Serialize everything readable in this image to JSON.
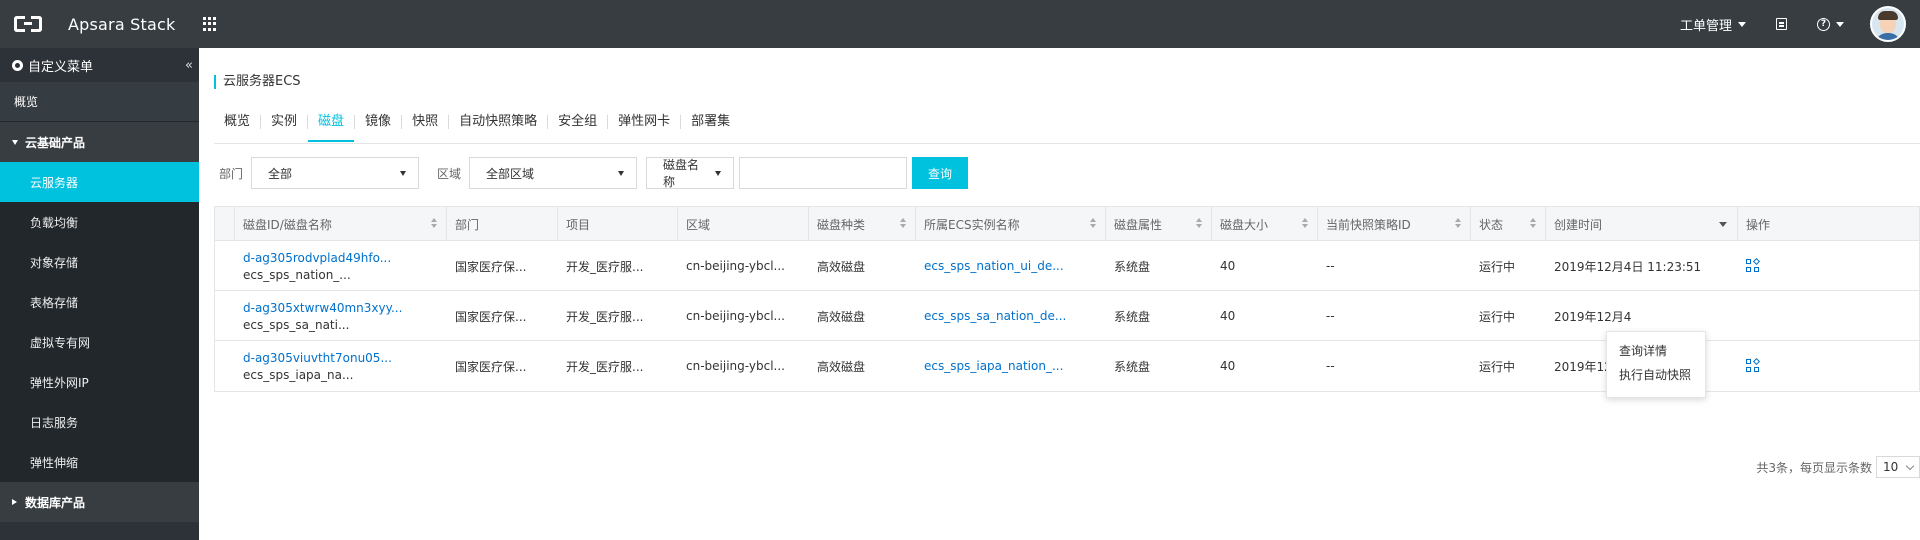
{
  "topbar": {
    "brand": "Apsara Stack",
    "ticket_menu": "工单管理",
    "help_symbol": "?"
  },
  "sidebar": {
    "header": "自定义菜单",
    "collapse_symbol": "«",
    "overview": "概览",
    "group_cloud": "云基础产品",
    "items": [
      "云服务器",
      "负载均衡",
      "对象存储",
      "表格存储",
      "虚拟专有网",
      "弹性外网IP",
      "日志服务",
      "弹性伸缩"
    ],
    "active_index": 0,
    "group_db": "数据库产品"
  },
  "main": {
    "title": "云服务器ECS",
    "tabs": [
      "概览",
      "实例",
      "磁盘",
      "镜像",
      "快照",
      "自动快照策略",
      "安全组",
      "弹性网卡",
      "部署集"
    ],
    "active_tab": "磁盘"
  },
  "filters": {
    "dept_label": "部门",
    "dept_value": "全部",
    "region_label": "区域",
    "region_value": "全部区域",
    "search_field": "磁盘名称",
    "search_value": "",
    "query_button": "查询"
  },
  "table": {
    "columns": [
      "磁盘ID/磁盘名称",
      "部门",
      "项目",
      "区域",
      "磁盘种类",
      "所属ECS实例名称",
      "磁盘属性",
      "磁盘大小",
      "当前快照策略ID",
      "状态",
      "创建时间",
      "操作"
    ],
    "rows": [
      {
        "id": "d-ag305rodvplad49hfo...",
        "name": "ecs_sps_nation_...",
        "dept": "国家医疗保...",
        "project": "开发_医疗服...",
        "region": "cn-beijing-ybcl...",
        "type": "高效磁盘",
        "instance": "ecs_sps_nation_ui_de...",
        "attr": "系统盘",
        "size": "40",
        "policy": "--",
        "status": "运行中",
        "created": "2019年12月4日 11:23:51"
      },
      {
        "id": "d-ag305xtwrw40mn3xyy...",
        "name": "ecs_sps_sa_nati...",
        "dept": "国家医疗保...",
        "project": "开发_医疗服...",
        "region": "cn-beijing-ybcl...",
        "type": "高效磁盘",
        "instance": "ecs_sps_sa_nation_de...",
        "attr": "系统盘",
        "size": "40",
        "policy": "--",
        "status": "运行中",
        "created": "2019年12月4"
      },
      {
        "id": "d-ag305viuvtht7onu05...",
        "name": "ecs_sps_iapa_na...",
        "dept": "国家医疗保...",
        "project": "开发_医疗服...",
        "region": "cn-beijing-ybcl...",
        "type": "高效磁盘",
        "instance": "ecs_sps_iapa_nation_...",
        "attr": "系统盘",
        "size": "40",
        "policy": "--",
        "status": "运行中",
        "created": "2019年12月4日 11:20:55"
      }
    ]
  },
  "popup": {
    "items": [
      "查询详情",
      "执行自动快照"
    ]
  },
  "pagination": {
    "summary": "共3条，每页显示条数",
    "page_size": "10"
  },
  "colors": {
    "accent": "#00c1de",
    "topbar": "#373d41",
    "sidebar": "#2c3237",
    "link": "#0070cc"
  }
}
